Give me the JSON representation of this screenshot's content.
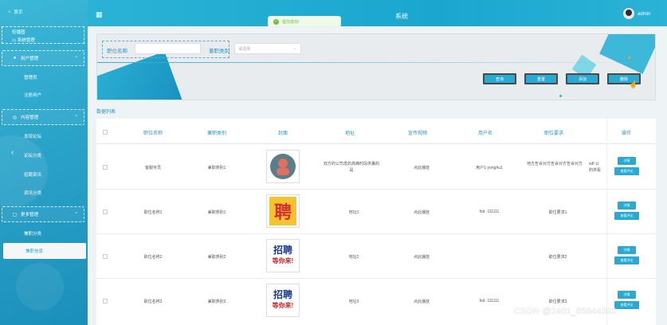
{
  "header": {
    "title": "系统",
    "user": "admin"
  },
  "toast": {
    "text": "提交成功!"
  },
  "sidebar": {
    "home": "首页",
    "sys_top": "系统管理",
    "sys_sub": "轮播图",
    "user_group": "用户管理",
    "user_items": [
      "管理员",
      "注册用户"
    ],
    "content_group": "内容管理",
    "content_items": [
      "发现论坛",
      "论坛分类",
      "招聘资讯",
      "资讯分类"
    ],
    "more_group": "更多管理",
    "more_items": [
      "兼职分类",
      "兼职信息"
    ]
  },
  "search": {
    "name_label": "职位名称",
    "type_label": "兼职类别",
    "type_placeholder": "请选择",
    "buttons": {
      "query": "查询",
      "reset": "重置",
      "add": "添加",
      "delete": "删除"
    }
  },
  "list_title": "数据列表",
  "table": {
    "headers": [
      "职位名称",
      "兼职类别",
      "封面",
      "地址",
      "宣传视频",
      "用户名",
      "职位要求",
      "操作"
    ],
    "rows": [
      {
        "name": "客服专员",
        "type": "兼职类别1",
        "address": "双方的公司发的高峰时段供暑的是",
        "video": "点此播放",
        "user": "用户1-yonghu1",
        "req": "地方告诉对方告诉对方告诉对方",
        "extra": "sdf 公\n的供看",
        "cover": "person"
      },
      {
        "name": "职位名称1",
        "type": "兼职类别1",
        "address": "地址1",
        "video": "点此播放",
        "user": "fsd -111111",
        "req": "职位要求1",
        "extra": "",
        "cover": "pin"
      },
      {
        "name": "职位名称2",
        "type": "兼职类别2",
        "address": "地址2",
        "video": "点此播放",
        "user": "",
        "req": "职位要求2",
        "extra": "",
        "cover": "zhaopin"
      },
      {
        "name": "职位名称3",
        "type": "兼职类别3",
        "address": "地址3",
        "video": "点此播放",
        "user": "fsd -111111",
        "req": "职位要求3",
        "extra": "",
        "cover": "zhaopin"
      }
    ],
    "actions": {
      "detail": "详情",
      "view_review": "查看评论"
    }
  },
  "cover_text": {
    "pin": "聘",
    "zhaopin_1": "招聘",
    "zhaopin_2": "等你来!"
  },
  "watermark": "CSDN @2401_85644395"
}
